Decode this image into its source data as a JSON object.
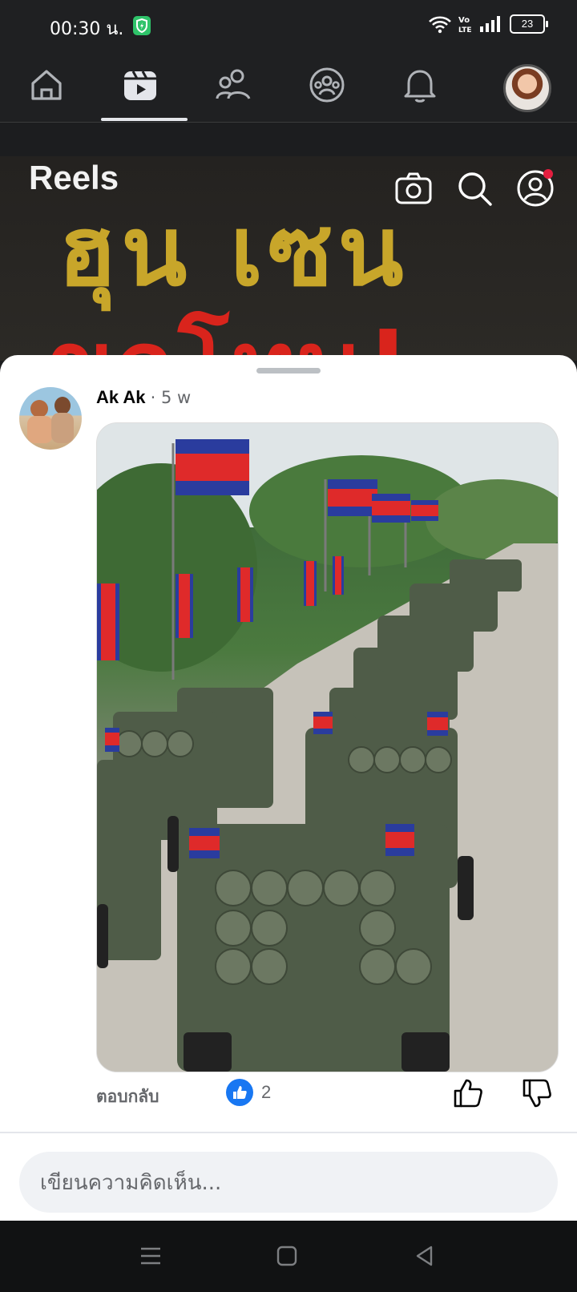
{
  "status_bar": {
    "time": "00:30 น.",
    "battery": "23"
  },
  "nav": {
    "items": [
      {
        "label": "Home",
        "icon": "home-icon"
      },
      {
        "label": "Reels",
        "icon": "reels-icon",
        "active": true
      },
      {
        "label": "Friends",
        "icon": "friends-icon"
      },
      {
        "label": "Groups",
        "icon": "groups-icon"
      },
      {
        "label": "Notifications",
        "icon": "bell-icon"
      },
      {
        "label": "Profile",
        "icon": "profile-avatar"
      }
    ]
  },
  "reels": {
    "title": "Reels",
    "background_text_top": "ฮุน เซน",
    "background_text_bottom": "ขอโทษ!",
    "icons": [
      "camera-icon",
      "search-icon",
      "profile-icon"
    ]
  },
  "comment": {
    "author": "Ak Ak",
    "age": "· 5 w",
    "image_alt": "Cambodian flags and military rocket launcher trucks lined up on a road",
    "reply_label": "ตอบกลับ",
    "like_count": "2"
  },
  "composer": {
    "placeholder": "เขียนความคิดเห็น..."
  },
  "colors": {
    "accent": "#1877f2",
    "sheet": "#ffffff",
    "dark": "#1f2022"
  }
}
